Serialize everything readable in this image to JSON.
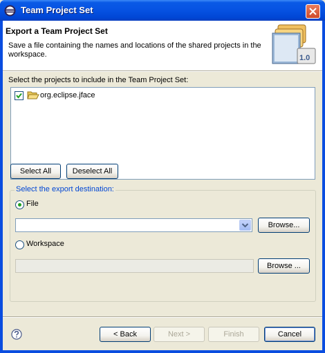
{
  "window": {
    "title": "Team Project Set"
  },
  "banner": {
    "title": "Export a Team Project Set",
    "description": "Save a file containing the names and locations of the shared projects in the workspace.",
    "badge_text": "1.0"
  },
  "projects": {
    "label": "Select the projects to include in the Team Project Set:",
    "items": [
      {
        "label": "org.eclipse.jface",
        "checked": true
      }
    ]
  },
  "selection_buttons": {
    "select_all": "Select All",
    "deselect_all": "Deselect All"
  },
  "destination": {
    "group_title": "Select the export destination:",
    "file_option": "File",
    "file_selected": true,
    "file_path": "",
    "browse_file": "Browse...",
    "workspace_option": "Workspace",
    "workspace_path": "",
    "browse_workspace": "Browse ..."
  },
  "footer": {
    "back": "< Back",
    "next": "Next >",
    "finish": "Finish",
    "cancel": "Cancel"
  },
  "colors": {
    "titlebar": "#0a5ae6",
    "group_title": "#0046d5",
    "radio_dot": "#21a121"
  },
  "icons": {
    "app": "eclipse-icon",
    "close": "close-icon",
    "project": "open-folder-icon",
    "help": "help-icon"
  }
}
